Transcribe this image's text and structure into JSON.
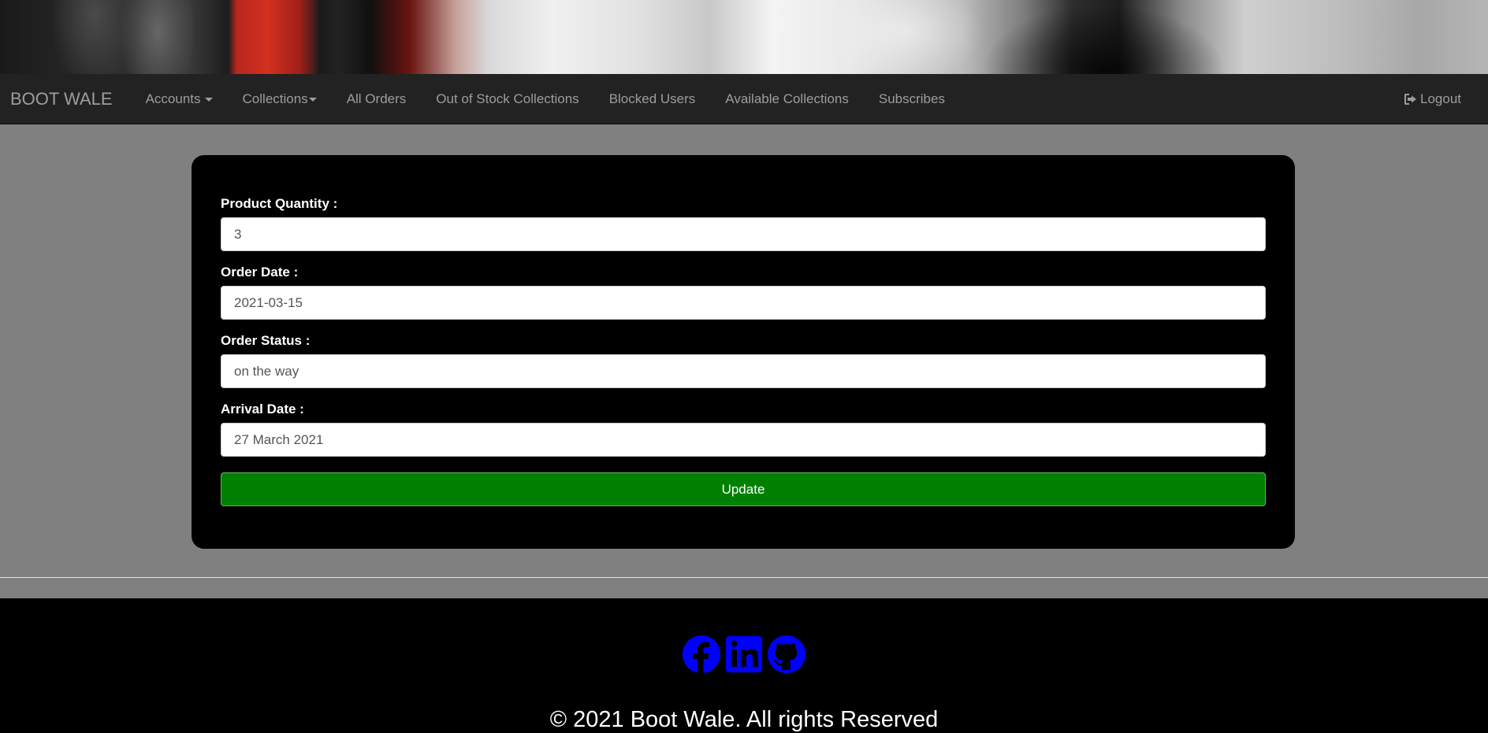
{
  "navbar": {
    "brand": "BOOT WALE",
    "items": [
      {
        "label": "Accounts",
        "dropdown": true
      },
      {
        "label": "Collections",
        "dropdown": true
      },
      {
        "label": "All Orders",
        "dropdown": false
      },
      {
        "label": "Out of Stock Collections",
        "dropdown": false
      },
      {
        "label": "Blocked Users",
        "dropdown": false
      },
      {
        "label": "Available Collections",
        "dropdown": false
      },
      {
        "label": "Subscribes",
        "dropdown": false
      }
    ],
    "logout_label": "Logout",
    "logout_icon": "logout-icon"
  },
  "form": {
    "fields": [
      {
        "label": "Product Quantity :",
        "value": "3"
      },
      {
        "label": "Order Date :",
        "value": "2021-03-15"
      },
      {
        "label": "Order Status :",
        "value": "on the way"
      },
      {
        "label": "Arrival Date :",
        "value": "27 March 2021"
      }
    ],
    "submit_label": "Update"
  },
  "footer": {
    "socials": [
      "facebook-icon",
      "linkedin-icon",
      "github-icon"
    ],
    "social_color": "#0000ff",
    "copyright": "© 2021 Boot Wale. All rights Reserved"
  },
  "colors": {
    "navbar_bg": "#222222",
    "page_bg": "#808080",
    "card_bg": "#000000",
    "button_bg": "#008000"
  }
}
